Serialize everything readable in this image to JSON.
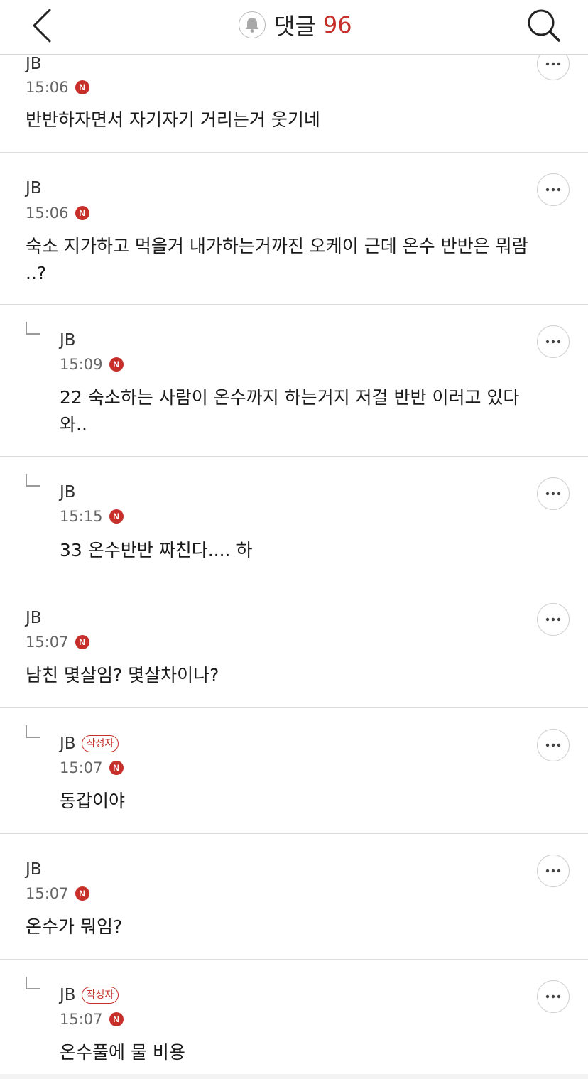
{
  "header": {
    "title": "댓글",
    "count": "96"
  },
  "comments": [
    {
      "author": "JB",
      "badge": "",
      "time": "15:06",
      "n": "N",
      "text": "반반하자면서 자기자기 거리는거 웃기네"
    },
    {
      "author": "JB",
      "badge": "",
      "time": "15:06",
      "n": "N",
      "text": "숙소 지가하고 먹을거 내가하는거까진 오케이 근데 온수 반반은 뭐람 ..?"
    },
    {
      "author": "JB",
      "badge": "",
      "time": "15:09",
      "n": "N",
      "text": "22 숙소하는 사람이 온수까지 하는거지 저걸 반반 이러고 있다 와.."
    },
    {
      "author": "JB",
      "badge": "",
      "time": "15:15",
      "n": "N",
      "text": "33 온수반반 짜친다.... 하"
    },
    {
      "author": "JB",
      "badge": "",
      "time": "15:07",
      "n": "N",
      "text": "남친 몇살임? 몇살차이나?"
    },
    {
      "author": "JB",
      "badge": "작성자",
      "time": "15:07",
      "n": "N",
      "text": "동갑이야"
    },
    {
      "author": "JB",
      "badge": "",
      "time": "15:07",
      "n": "N",
      "text": "온수가 뭐임?"
    },
    {
      "author": "JB",
      "badge": "작성자",
      "time": "15:07",
      "n": "N",
      "text": "온수풀에 물 비용"
    }
  ],
  "colors": {
    "accent": "#c72f2a",
    "divider": "#dcdcdc"
  }
}
